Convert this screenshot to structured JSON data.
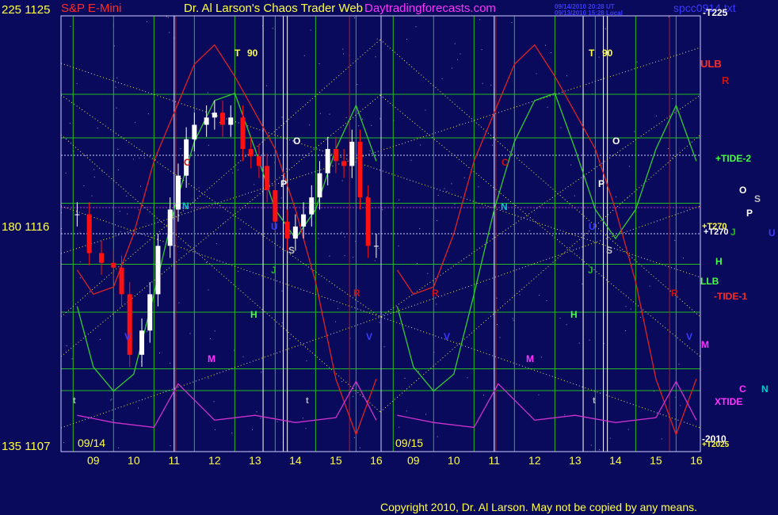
{
  "header": {
    "symbol": "S&P E-Mini",
    "title": "Dr. Al Larson's Chaos Trader Web",
    "site": "Daytradingforecasts.com",
    "stamp_line1": "09/14/2010 20:28 UT",
    "stamp_line2": "09/13/2010 15:28 Local",
    "corner": "spcc0914.txt"
  },
  "footer": {
    "copyright": "Copyright 2010, Dr. Al Larson. May not be copied by any means."
  },
  "left_axis": {
    "top": "225 1125",
    "mid": "180 1116",
    "bottom": "135 1107"
  },
  "dates": [
    "09/14",
    "09/15"
  ],
  "right_labels": {
    "t225": "-T225",
    "ulb": "ULB",
    "r": "R",
    "tide2": "+TIDE-2",
    "o": "O",
    "s": "S",
    "p": "P",
    "u": "U",
    "t270a": "+T270",
    "t270b": "+T270",
    "j": "J",
    "h": "H",
    "llb": "LLB",
    "tide1": "-TIDE-1",
    "m": "M",
    "c": "C",
    "n": "N",
    "xtide": "XTIDE",
    "t2010": "-2010",
    "t2025": "+T2025"
  },
  "planet_marks": {
    "t90": "T",
    "n90": "90",
    "n": "N",
    "o": "O",
    "p": "P",
    "s": "S",
    "j": "J",
    "h": "H",
    "m": "M",
    "c": "C",
    "r": "R",
    "v": "V",
    "u": "U",
    "t": "t"
  },
  "colors": {
    "background": "#0a0a5c",
    "grid_green": "#22bb22",
    "white_line": "#ffffff",
    "red_line": "#cc1111",
    "price_up": "#ffffff",
    "price_down": "#ff1111",
    "xtide": "#cc33cc",
    "diag": "#e6e650",
    "header_title": "#ffff44",
    "site": "#ff33ff"
  },
  "chart_data": {
    "type": "candlestick",
    "title": "S&P E-Mini",
    "ylim": [
      1107,
      1125
    ],
    "y_axis_labels": [
      "225 1125",
      "180 1116",
      "135 1107"
    ],
    "x_tick_labels": [
      "09",
      "10",
      "11",
      "12",
      "13",
      "14",
      "15",
      "16",
      "09",
      "10",
      "11",
      "12",
      "13",
      "14",
      "15",
      "16"
    ],
    "sessions": [
      "09/14",
      "09/15"
    ],
    "series": [
      {
        "name": "price_close",
        "x_hours": [
          8.6,
          8.9,
          9.2,
          9.5,
          9.7,
          9.9,
          10.2,
          10.4,
          10.6,
          10.9,
          11.1,
          11.3,
          11.5,
          11.8,
          12.0,
          12.2,
          12.4,
          12.7,
          12.9,
          13.1,
          13.3,
          13.5,
          13.8,
          14.0,
          14.2,
          14.4,
          14.6,
          14.8,
          15.0,
          15.2,
          15.4,
          15.6,
          15.8,
          16.0
        ],
        "values": [
          1116.8,
          1115.2,
          1114.8,
          1114.6,
          1113.5,
          1111.0,
          1112.0,
          1113.5,
          1115.5,
          1117.0,
          1118.4,
          1119.9,
          1120.5,
          1120.8,
          1121.0,
          1120.5,
          1120.8,
          1119.5,
          1119.2,
          1118.8,
          1117.8,
          1116.5,
          1115.8,
          1116.3,
          1116.8,
          1117.5,
          1118.5,
          1119.5,
          1119.0,
          1118.8,
          1119.8,
          1117.5,
          1115.5,
          1115.5
        ]
      },
      {
        "name": "+TIDE-2",
        "x_hours": [
          8.6,
          9.0,
          9.5,
          10.0,
          10.5,
          11.0,
          11.5,
          12.0,
          12.5,
          13.0,
          13.5,
          14.0,
          14.5,
          15.0,
          15.5,
          16.0
        ],
        "values": [
          1113.0,
          1110.5,
          1109.5,
          1110.2,
          1113.5,
          1117.0,
          1119.8,
          1121.5,
          1121.8,
          1119.5,
          1117.0,
          1115.8,
          1117.0,
          1119.5,
          1121.3,
          1119.0
        ]
      },
      {
        "name": "-TIDE-1",
        "x_hours": [
          8.6,
          9.0,
          9.5,
          10.0,
          10.5,
          11.0,
          11.5,
          12.0,
          12.5,
          13.0,
          13.5,
          14.0,
          14.5,
          15.0,
          15.5,
          16.0
        ],
        "values": [
          1114.5,
          1113.5,
          1113.8,
          1116.0,
          1119.0,
          1121.0,
          1123.0,
          1123.8,
          1122.5,
          1121.0,
          1119.5,
          1117.0,
          1114.0,
          1110.0,
          1107.7,
          1110.0
        ]
      },
      {
        "name": "XTIDE",
        "x_hours": [
          8.6,
          9.5,
          10.5,
          11.1,
          12.0,
          13.0,
          14.0,
          15.0,
          15.5,
          16.0
        ],
        "values": [
          1108.5,
          1108.2,
          1108.0,
          1109.8,
          1108.3,
          1108.5,
          1108.2,
          1108.4,
          1109.9,
          1108.3
        ]
      }
    ]
  }
}
